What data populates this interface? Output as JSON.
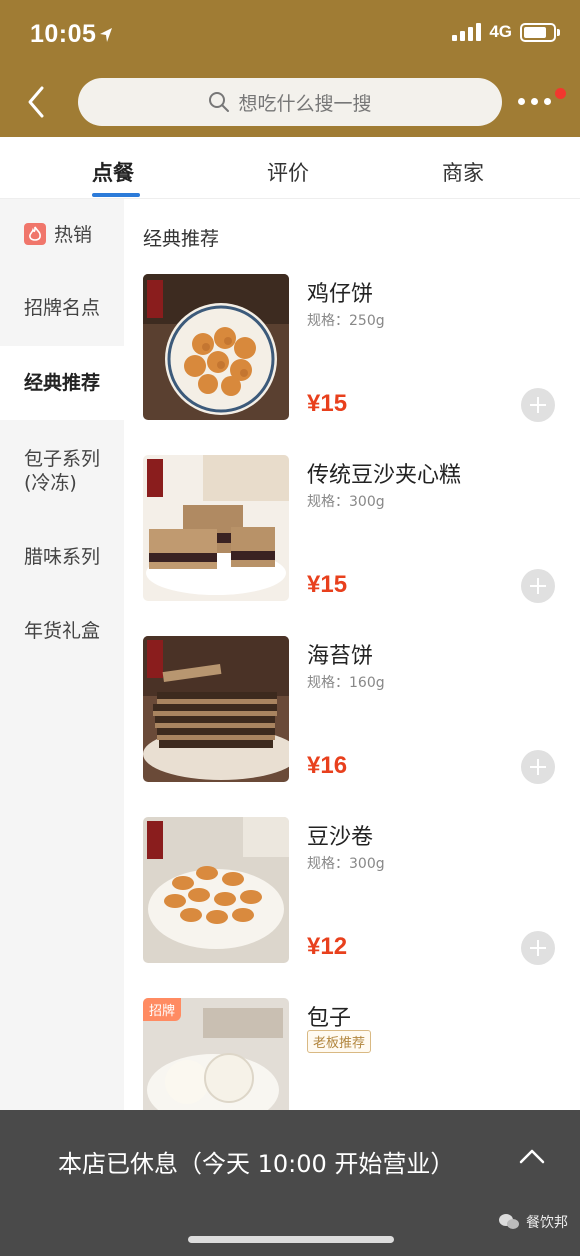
{
  "status": {
    "time": "10:05",
    "network": "4G"
  },
  "search": {
    "placeholder": "想吃什么搜一搜"
  },
  "tabs": [
    {
      "label": "点餐",
      "active": true
    },
    {
      "label": "评价",
      "active": false
    },
    {
      "label": "商家",
      "active": false
    }
  ],
  "sidebar": {
    "items": [
      {
        "label": "热销",
        "icon": "flame-icon"
      },
      {
        "label": "招牌名点"
      },
      {
        "label": "经典推荐",
        "active": true
      },
      {
        "label": "包子系列",
        "label2": "(冷冻)"
      },
      {
        "label": "腊味系列"
      },
      {
        "label": "年货礼盒"
      }
    ]
  },
  "section": {
    "title": "经典推荐"
  },
  "products": [
    {
      "name": "鸡仔饼",
      "spec": "规格：250g",
      "price": "¥15"
    },
    {
      "name": "传统豆沙夹心糕",
      "spec": "规格：300g",
      "price": "¥15"
    },
    {
      "name": "海苔饼",
      "spec": "规格：160g",
      "price": "¥16"
    },
    {
      "name": "豆沙卷",
      "spec": "规格：300g",
      "price": "¥12"
    },
    {
      "name": "包子",
      "badge": "老板推荐",
      "tag": "招牌"
    }
  ],
  "footer": {
    "closed_text": "本店已休息（今天 10:00 开始营业）"
  },
  "watermark": {
    "text": "餐饮邦"
  },
  "colors": {
    "header": "#a07c34",
    "accent": "#2c7bd9",
    "price": "#e8401d",
    "closed_bar": "#4a4a4a"
  }
}
